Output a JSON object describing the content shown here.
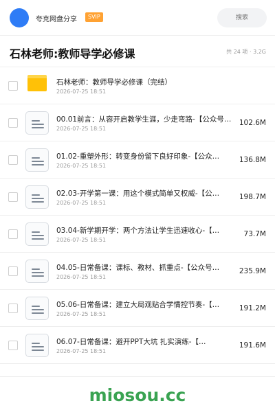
{
  "header": {
    "username": "夸克网盘分享",
    "badge": "SVIP",
    "search_placeholder": "搜索"
  },
  "titlebar": {
    "title": "石林老师:教师导学必修课",
    "summary": "共 24 项 · 3.2G"
  },
  "items": [
    {
      "type": "folder",
      "name": "石林老师：教师导学必修课（完结）",
      "date": "2026-07-25 18:51",
      "size": ""
    },
    {
      "type": "file",
      "name": "00.01前言：从容开启教学生涯，少走弯路-【公众号…",
      "date": "2026-07-25 18:51",
      "size": "102.6M"
    },
    {
      "type": "file",
      "name": "01.02-重塑外形：转变身份留下良好印象-【公众…",
      "date": "2026-07-25 18:51",
      "size": "136.8M"
    },
    {
      "type": "file",
      "name": "02.03-开学第一课：用这个模式简单又权威-【公…",
      "date": "2026-07-25 18:51",
      "size": "198.7M"
    },
    {
      "type": "file",
      "name": "03.04-新学期开学：两个方法让学生迅速收心-【…",
      "date": "2026-07-25 18:51",
      "size": "73.7M"
    },
    {
      "type": "file",
      "name": "04.05-日常备课：课标、教材、抓重点-【公众号…",
      "date": "2026-07-25 18:51",
      "size": "235.9M"
    },
    {
      "type": "file",
      "name": "05.06-日常备课：建立大局观贴合学情控节奏-【…",
      "date": "2026-07-25 18:51",
      "size": "191.2M"
    },
    {
      "type": "file",
      "name": "06.07-日常备课：避开PPT大坑 扎实演练-【…",
      "date": "2026-07-25 18:51",
      "size": "191.6M"
    }
  ],
  "footer": {
    "watermark": "miosou.cc",
    "watermark_color": "#3aa352"
  },
  "colors": {
    "avatar": "#2e7cf6",
    "badge": "#ffa233",
    "folder": "#ffc107"
  }
}
